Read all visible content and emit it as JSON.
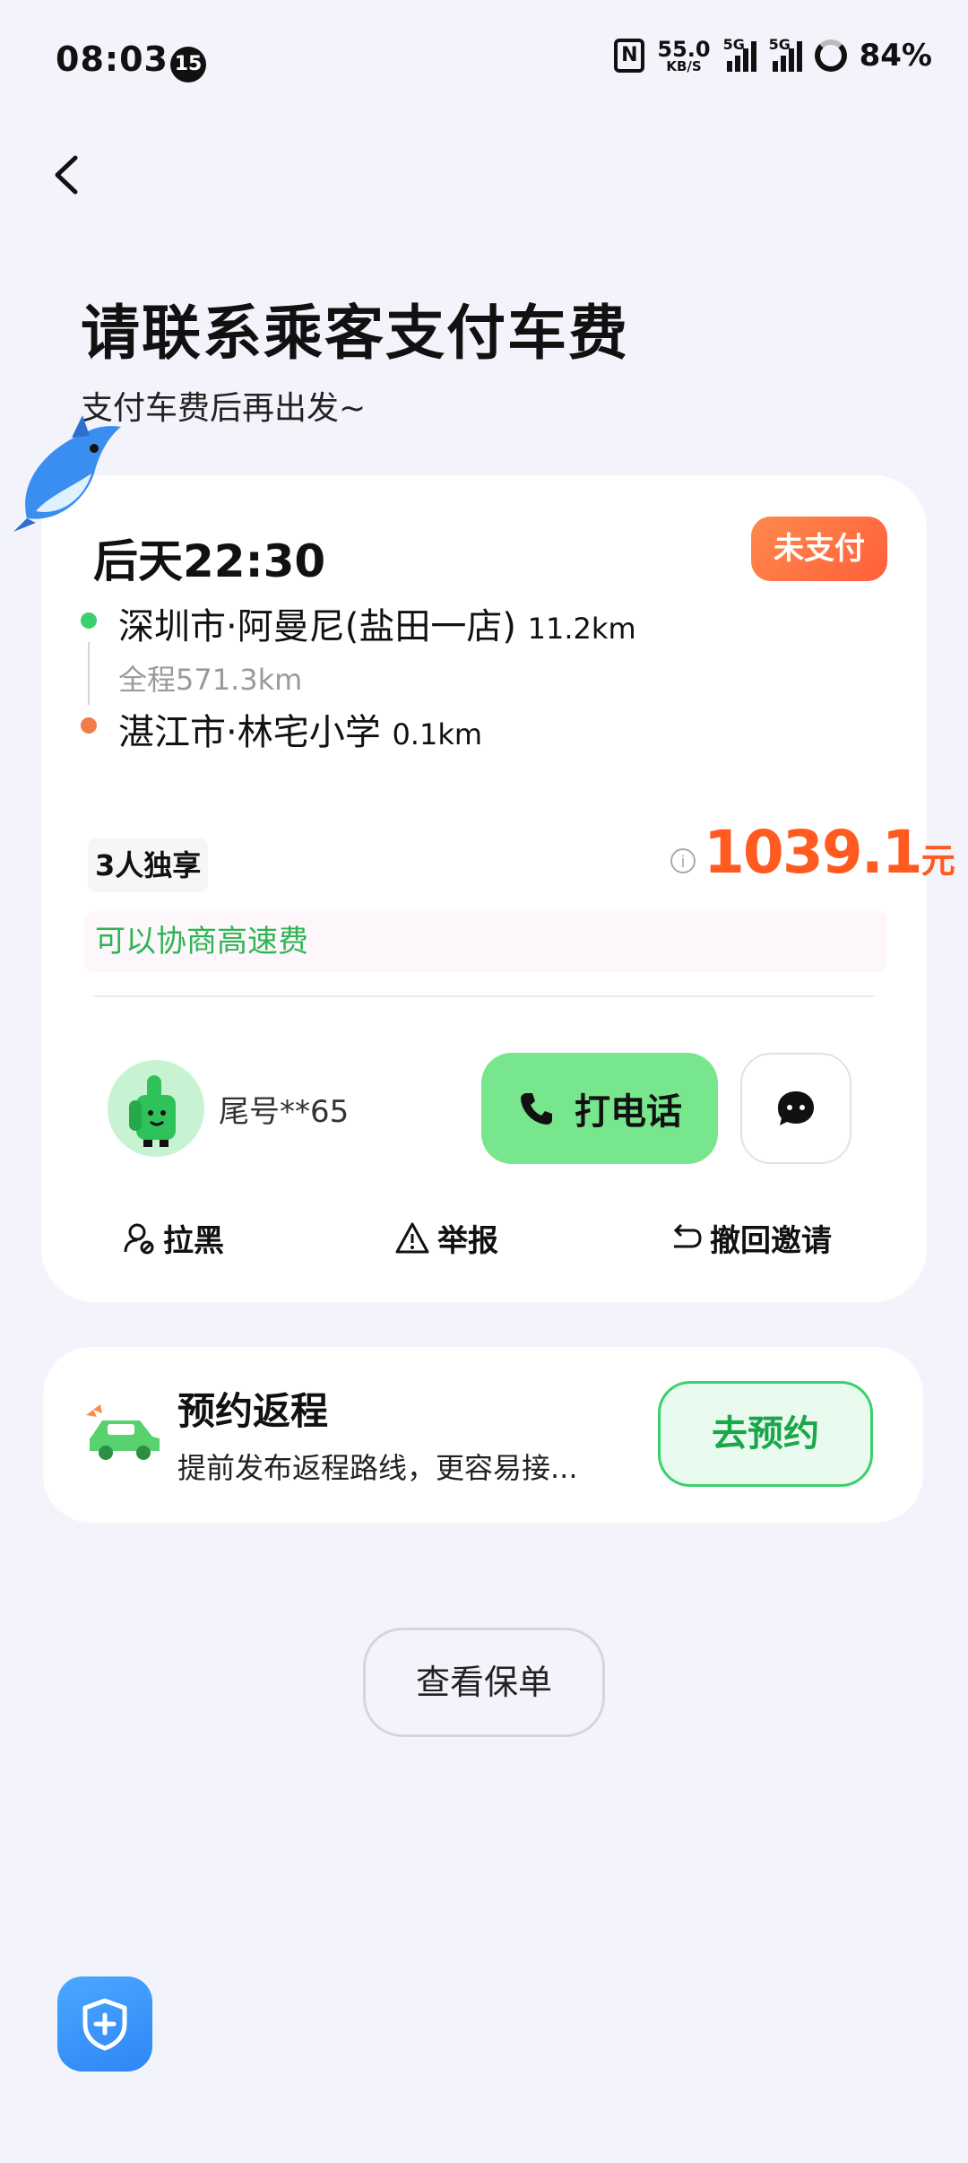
{
  "status_bar": {
    "time": "08:03",
    "notification_count": "15",
    "nfc_label": "N",
    "net_speed": "55.0",
    "net_speed_unit": "KB/S",
    "signal1_label": "5G",
    "signal2_label": "5G",
    "battery": "84%"
  },
  "header": {
    "title": "请联系乘客支付车费",
    "subtitle": "支付车费后再出发~"
  },
  "order": {
    "date_time": "后天22:30",
    "status": "未支付",
    "from": "深圳市·阿曼尼(盐田一店)",
    "from_distance": "11.2km",
    "total_distance": "全程571.3km",
    "to": "湛江市·林宅小学",
    "to_distance": "0.1km",
    "ride_type": "3人独享",
    "price": "1039.1",
    "price_unit": "元",
    "toll_note": "可以协商高速费",
    "passenger_tail": "尾号**65",
    "call_label": "打电话",
    "actions": {
      "block": "拉黑",
      "report": "举报",
      "revoke": "撤回邀请"
    }
  },
  "return_trip": {
    "title": "预约返程",
    "desc": "提前发布返程路线，更容易接...",
    "button": "去预约"
  },
  "policy_button": "查看保单",
  "colors": {
    "accent_green": "#78e68c",
    "price_orange": "#ff5a1f",
    "unpaid_badge": "#ff6f40",
    "shield_blue": "#3b96fa",
    "background": "#f3f4fb"
  }
}
